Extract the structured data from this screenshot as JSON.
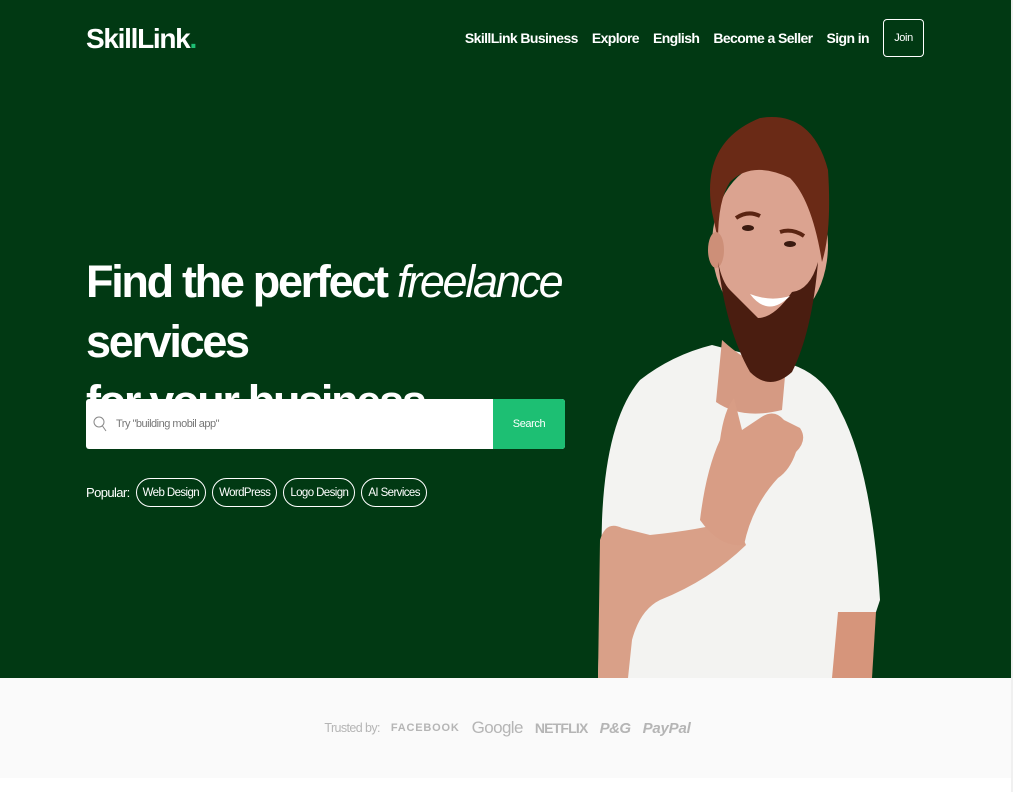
{
  "header": {
    "logo": "SkillLink",
    "logo_dot": ".",
    "nav": [
      "SkillLink Business",
      "Explore",
      "English",
      "Become a Seller",
      "Sign in"
    ],
    "join_label": "Join"
  },
  "hero": {
    "headline_part1": "Find the perfect",
    "headline_em": "freelance",
    "headline_part2": "services",
    "headline_line2": "for your business",
    "search_placeholder": "Try \"building mobil app\"",
    "search_button": "Search",
    "popular_label": "Popular:",
    "popular_tags": [
      "Web Design",
      "WordPress",
      "Logo Design",
      "AI Services"
    ]
  },
  "trusted": {
    "label": "Trusted by:",
    "brands": [
      "FACEBOOK",
      "Google",
      "NETFLIX",
      "P&G",
      "PayPal"
    ]
  },
  "colors": {
    "hero_bg": "#013913",
    "accent": "#1dbf73",
    "trusted_bg": "#fafafa",
    "trusted_text": "#b5b5b5"
  },
  "icons": [
    "search-icon"
  ]
}
